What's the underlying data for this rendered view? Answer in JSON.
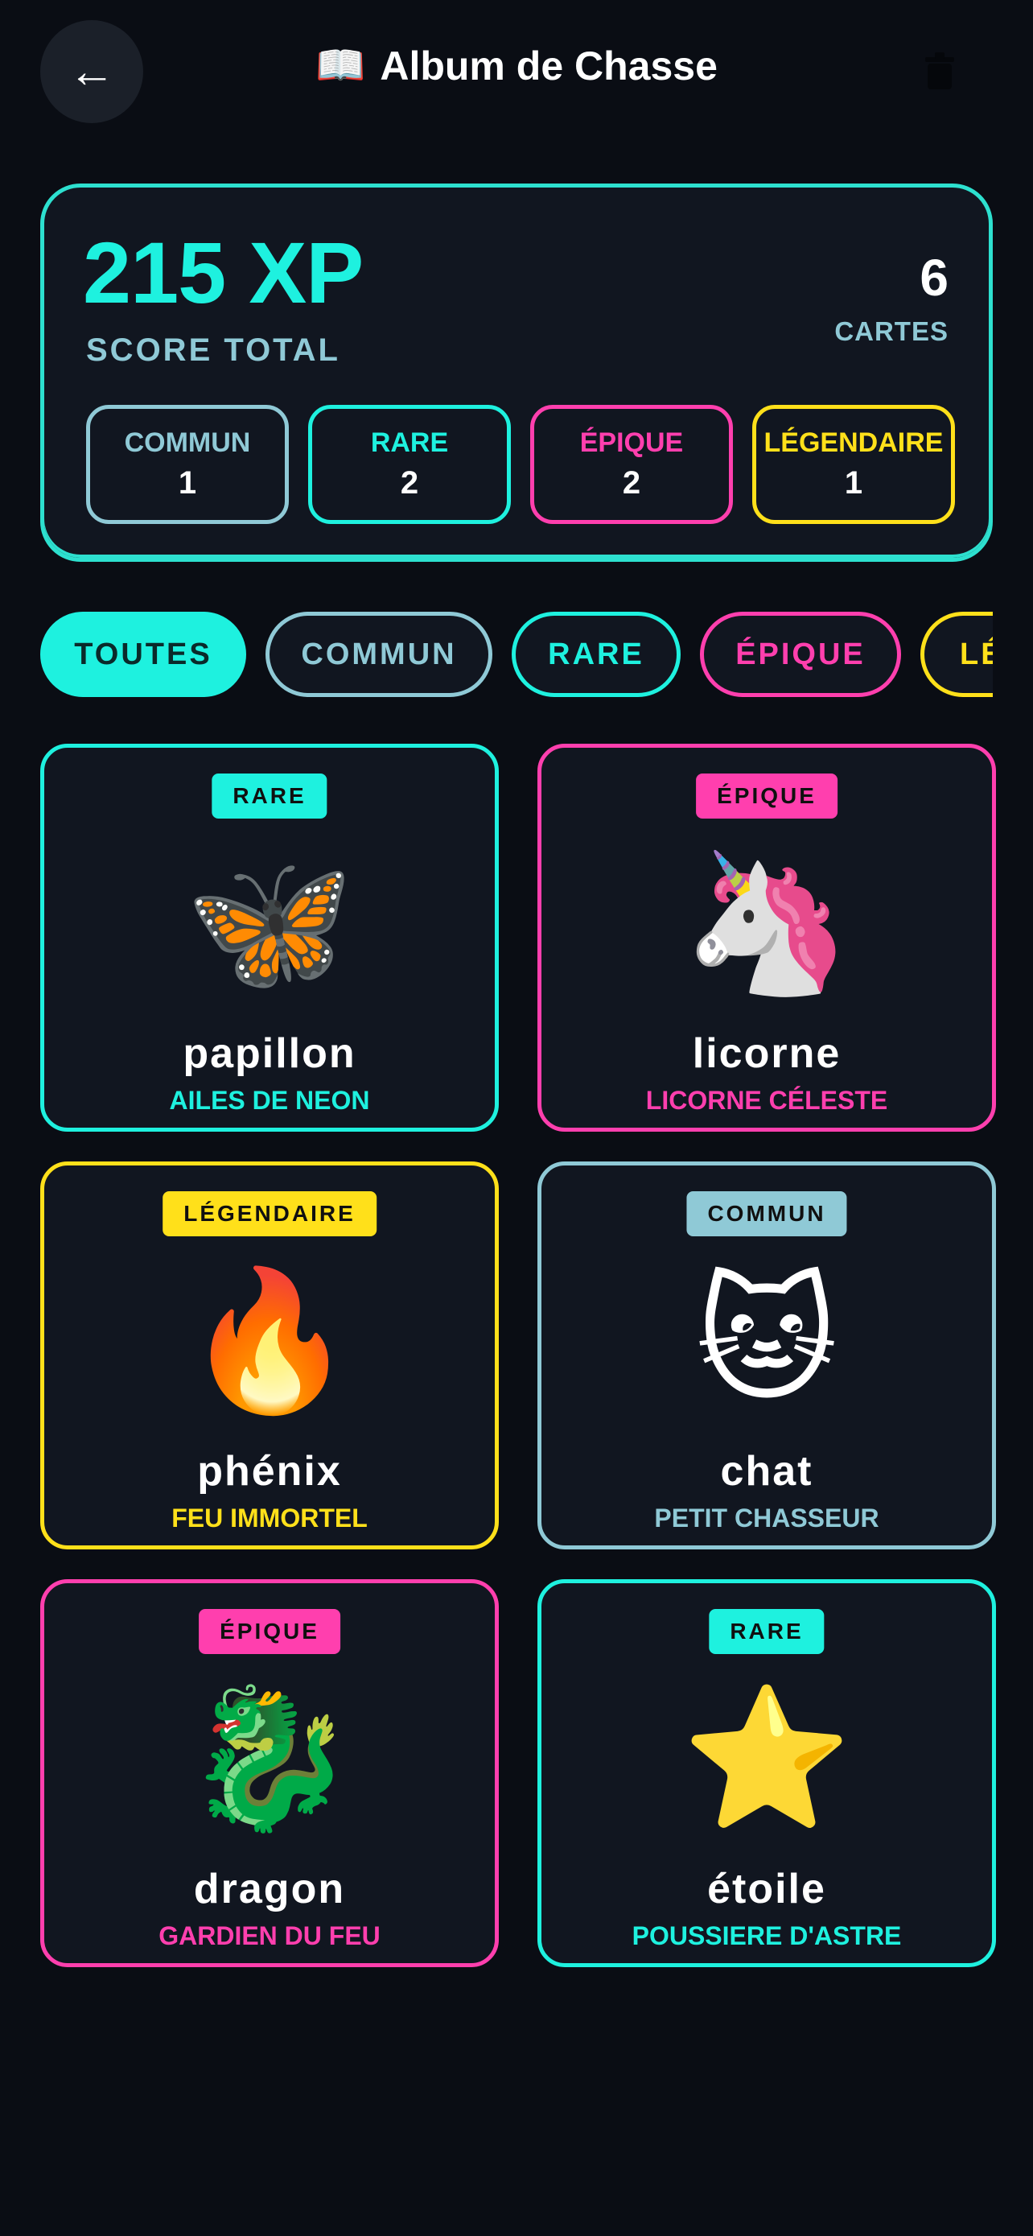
{
  "header": {
    "back_symbol": "←",
    "title_icon": "📖",
    "title": "Album de Chasse"
  },
  "summary": {
    "xp": "215 XP",
    "score_label": "SCORE TOTAL",
    "card_count": "6",
    "card_count_label": "CARTES",
    "rarities": [
      {
        "name": "COMMUN",
        "count": "1",
        "color": "#8fc9d6"
      },
      {
        "name": "RARE",
        "count": "2",
        "color": "#1ef1df"
      },
      {
        "name": "ÉPIQUE",
        "count": "2",
        "color": "#ff3fae"
      },
      {
        "name": "LÉGENDAIRE",
        "count": "1",
        "color": "#ffe01a"
      }
    ]
  },
  "filters": [
    {
      "label": "TOUTES",
      "active": true,
      "color": "#1ef1df"
    },
    {
      "label": "COMMUN",
      "active": false,
      "color": "#8fc9d6"
    },
    {
      "label": "RARE",
      "active": false,
      "color": "#1ef1df"
    },
    {
      "label": "ÉPIQUE",
      "active": false,
      "color": "#ff3fae"
    },
    {
      "label": "LÉGENDAIRE",
      "active": false,
      "color": "#ffe01a"
    }
  ],
  "cards": [
    {
      "rarity": "RARE",
      "emoji": "🦋",
      "name": "papillon",
      "subtitle": "AILES DE NEON",
      "color": "#1ef1df"
    },
    {
      "rarity": "ÉPIQUE",
      "emoji": "🦄",
      "name": "licorne",
      "subtitle": "LICORNE CÉLESTE",
      "color": "#ff3fae"
    },
    {
      "rarity": "LÉGENDAIRE",
      "emoji": "🔥",
      "name": "phénix",
      "subtitle": "FEU IMMORTEL",
      "color": "#ffe01a"
    },
    {
      "rarity": "COMMUN",
      "emoji": "🐱",
      "name": "chat",
      "subtitle": "PETIT CHASSEUR",
      "color": "#8fc9d6"
    },
    {
      "rarity": "ÉPIQUE",
      "emoji": "🐉",
      "name": "dragon",
      "subtitle": "GARDIEN DU FEU",
      "color": "#ff3fae"
    },
    {
      "rarity": "RARE",
      "emoji": "⭐",
      "name": "étoile",
      "subtitle": "POUSSIERE D'ASTRE",
      "color": "#1ef1df"
    }
  ]
}
